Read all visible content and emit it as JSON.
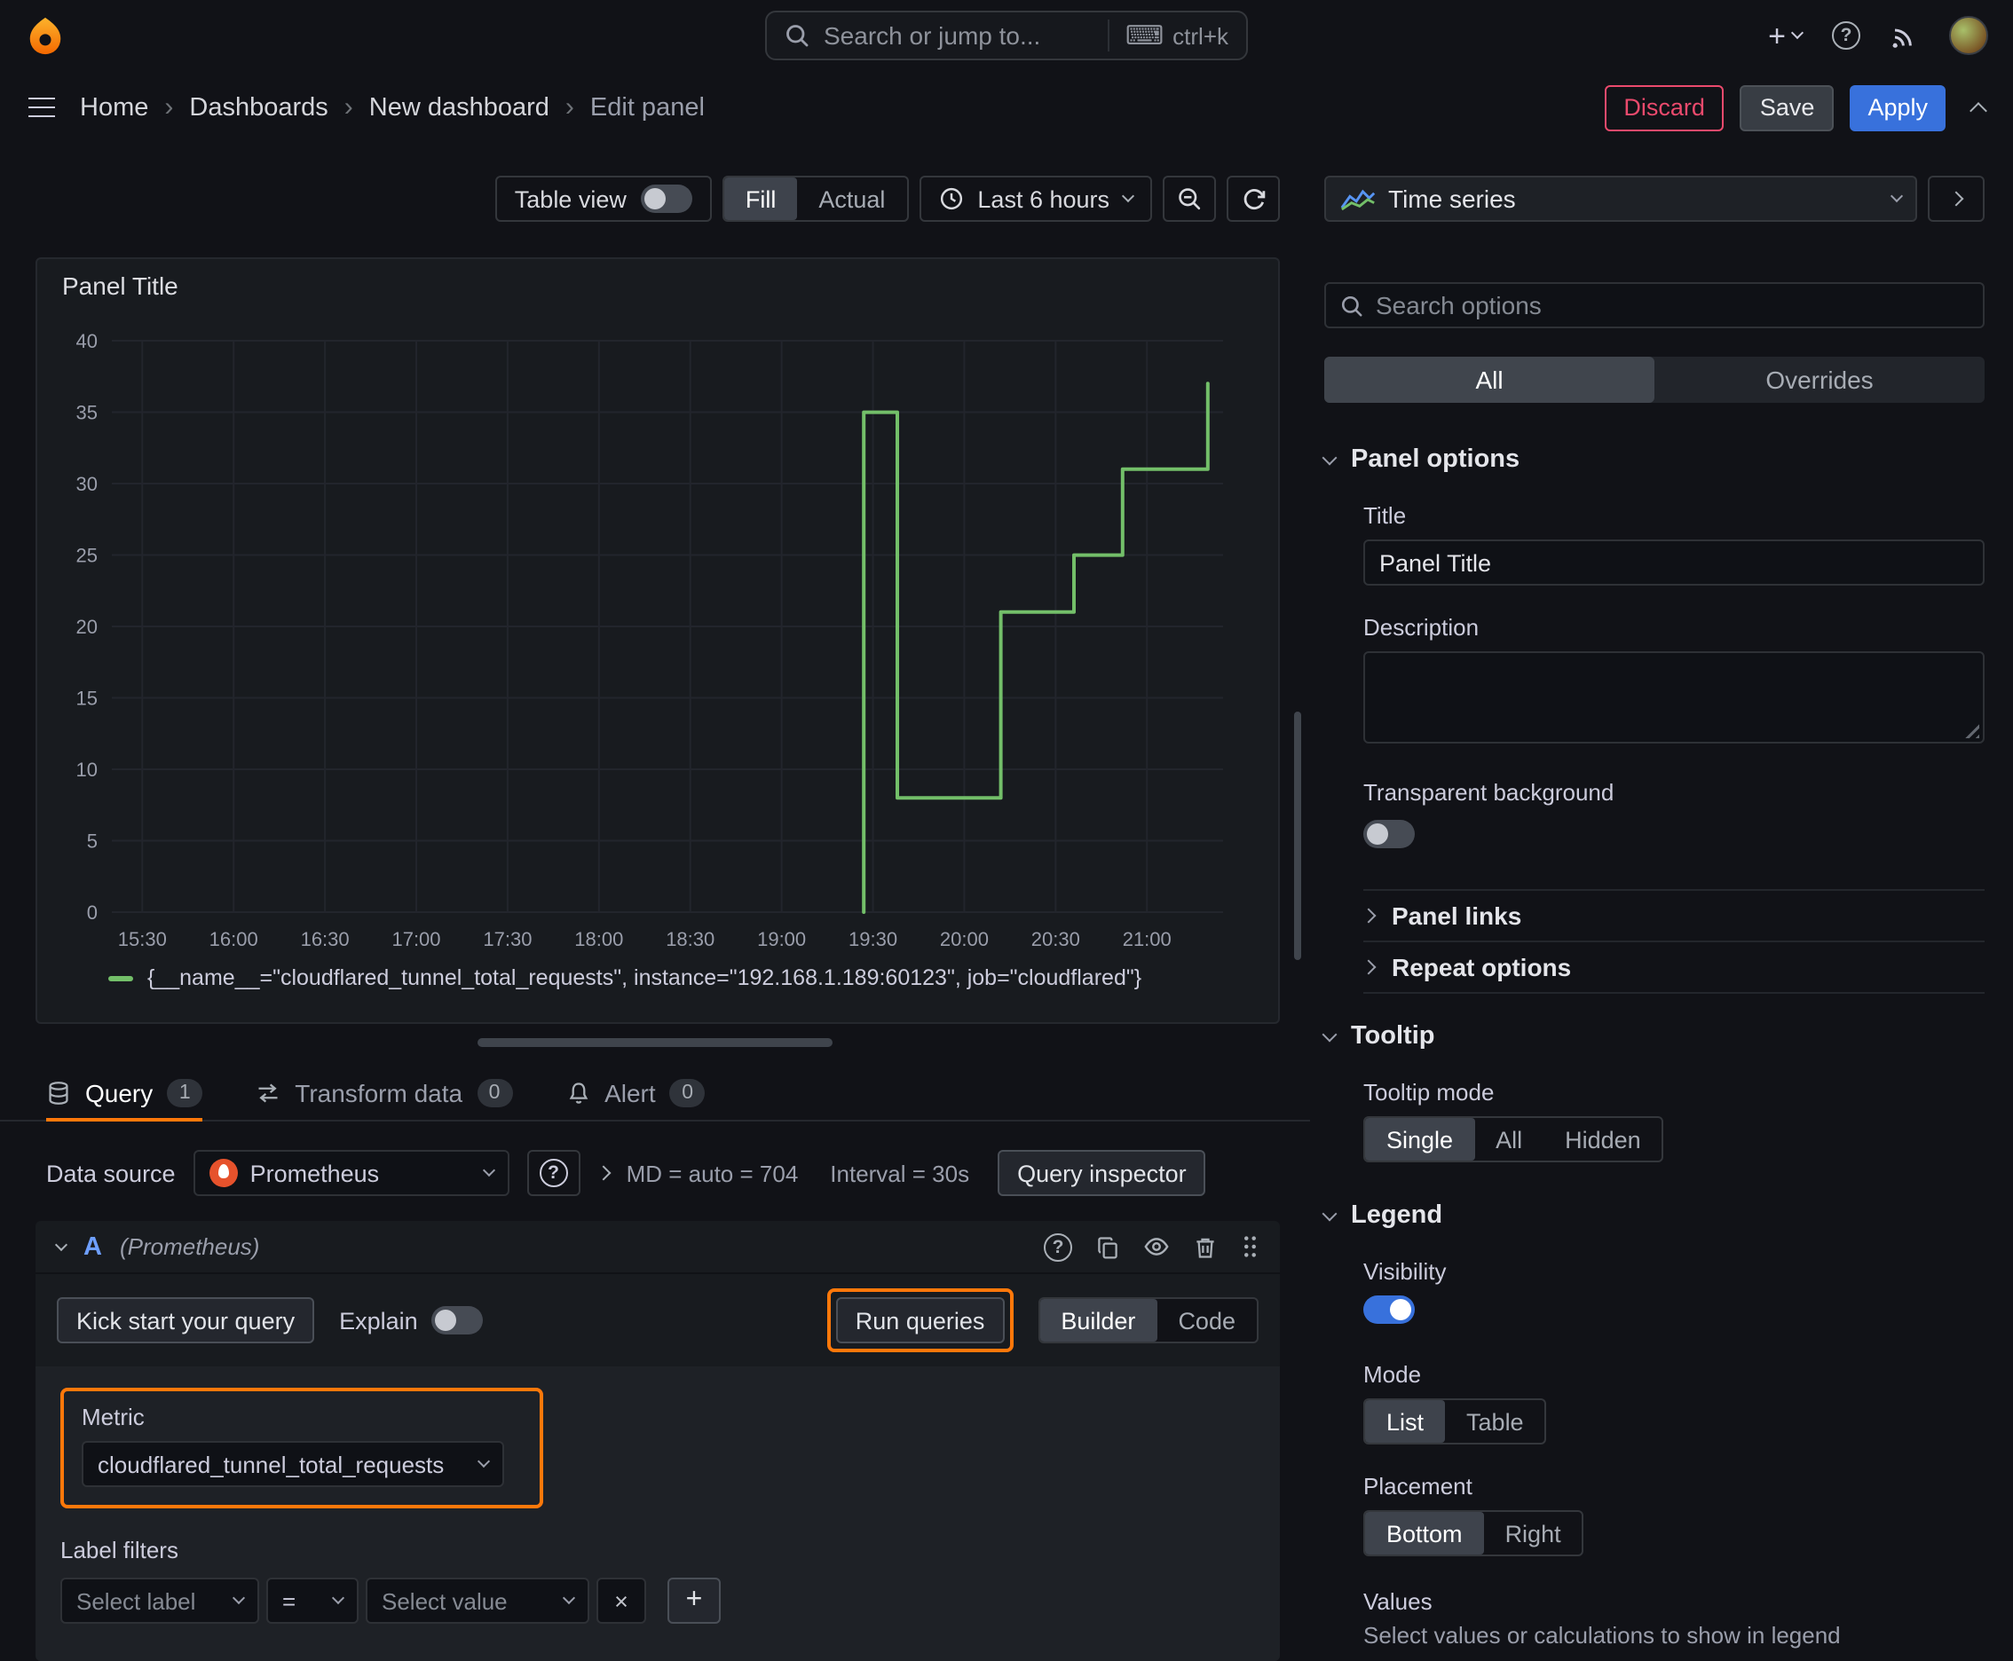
{
  "colors": {
    "background": "#111217",
    "panel_background": "#181b1f",
    "accent_blue": "#3871dc",
    "danger_red": "#eb4a6d",
    "series_green": "#73bf69",
    "highlight_orange": "#ff780a"
  },
  "topbar": {
    "search_placeholder": "Search or jump to...",
    "search_shortcut": "ctrl+k"
  },
  "breadcrumb": {
    "items": [
      "Home",
      "Dashboards",
      "New dashboard",
      "Edit panel"
    ]
  },
  "actions": {
    "discard": "Discard",
    "save": "Save",
    "apply": "Apply"
  },
  "toolbar": {
    "table_view_label": "Table view",
    "fill_label": "Fill",
    "actual_label": "Actual",
    "time_range_label": "Last 6 hours"
  },
  "panel": {
    "title": "Panel Title"
  },
  "chart_data": {
    "type": "line",
    "title": "Panel Title",
    "x_ticks": [
      "15:30",
      "16:00",
      "16:30",
      "17:00",
      "17:30",
      "18:00",
      "18:30",
      "19:00",
      "19:30",
      "20:00",
      "20:30",
      "21:00"
    ],
    "y_ticks": [
      0,
      5,
      10,
      15,
      20,
      25,
      30,
      35,
      40
    ],
    "x_domain_minutes": [
      920,
      1285
    ],
    "y_domain": [
      0,
      40
    ],
    "grid": true,
    "legend_position": "bottom",
    "series": [
      {
        "name": "{__name__=\"cloudflared_tunnel_total_requests\", instance=\"192.168.1.189:60123\", job=\"cloudflared\"}",
        "color": "#73bf69",
        "points": [
          [
            1167,
            0
          ],
          [
            1167,
            35
          ],
          [
            1178,
            35
          ],
          [
            1178,
            8
          ],
          [
            1212,
            8
          ],
          [
            1212,
            21
          ],
          [
            1236,
            21
          ],
          [
            1236,
            25
          ],
          [
            1252,
            25
          ],
          [
            1252,
            31
          ],
          [
            1280,
            31
          ],
          [
            1280,
            37
          ]
        ]
      }
    ]
  },
  "tabs": [
    {
      "label": "Query",
      "count": "1"
    },
    {
      "label": "Transform data",
      "count": "0"
    },
    {
      "label": "Alert",
      "count": "0"
    }
  ],
  "query": {
    "datasource_label": "Data source",
    "datasource_name": "Prometheus",
    "stats_md": "MD = auto = 704",
    "stats_interval": "Interval = 30s",
    "inspector_label": "Query inspector",
    "ref_id": "A",
    "ref_ds": "(Prometheus)",
    "kick_start": "Kick start your query",
    "explain_label": "Explain",
    "run_queries": "Run queries",
    "builder": "Builder",
    "code": "Code",
    "metric_label": "Metric",
    "metric_value": "cloudflared_tunnel_total_requests",
    "label_filters_label": "Label filters",
    "select_label_placeholder": "Select label",
    "operator": "=",
    "select_value_placeholder": "Select value"
  },
  "sidebar": {
    "viz_type": "Time series",
    "search_placeholder": "Search options",
    "tabs": {
      "all": "All",
      "overrides": "Overrides"
    },
    "panel_options": {
      "title": "Panel options",
      "title_label": "Title",
      "title_value": "Panel Title",
      "description_label": "Description",
      "transparent_label": "Transparent background",
      "links_label": "Panel links",
      "repeat_label": "Repeat options"
    },
    "tooltip": {
      "title": "Tooltip",
      "mode_label": "Tooltip mode",
      "options": [
        "Single",
        "All",
        "Hidden"
      ],
      "selected": "Single"
    },
    "legend": {
      "title": "Legend",
      "visibility_label": "Visibility",
      "mode_label": "Mode",
      "mode_options": [
        "List",
        "Table"
      ],
      "mode_selected": "List",
      "placement_label": "Placement",
      "placement_options": [
        "Bottom",
        "Right"
      ],
      "placement_selected": "Bottom",
      "values_label": "Values",
      "values_hint": "Select values or calculations to show in legend"
    }
  }
}
